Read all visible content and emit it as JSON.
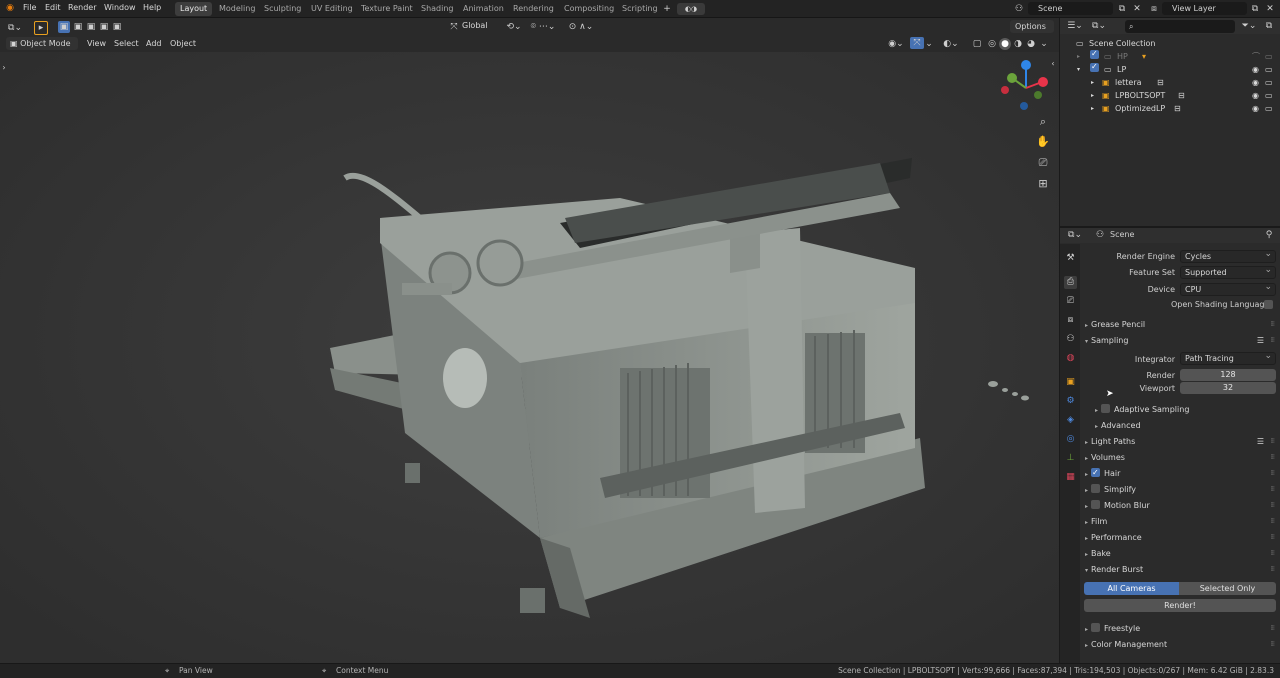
{
  "menu": [
    "File",
    "Edit",
    "Render",
    "Window",
    "Help"
  ],
  "workspaces": [
    "Layout",
    "Modeling",
    "Sculpting",
    "UV Editing",
    "Texture Paint",
    "Shading",
    "Animation",
    "Rendering",
    "Compositing",
    "Scripting"
  ],
  "active_workspace": "Layout",
  "scene_name": "Scene",
  "view_layer": "View Layer",
  "toolbar": {
    "orientation": "Global",
    "options": "Options"
  },
  "viewport_header": {
    "mode": "Object Mode",
    "menus": [
      "View",
      "Select",
      "Add",
      "Object"
    ]
  },
  "outliner": {
    "search_placeholder": "",
    "collection": "Scene Collection",
    "rows": [
      {
        "name": "HP",
        "level": 0
      },
      {
        "name": "LP",
        "level": 0
      },
      {
        "name": "lettera",
        "level": 1
      },
      {
        "name": "LPBOLTSOPT",
        "level": 1
      },
      {
        "name": "OptimizedLP",
        "level": 1
      }
    ]
  },
  "properties": {
    "header": "Scene",
    "render_engine_label": "Render Engine",
    "render_engine": "Cycles",
    "feature_set_label": "Feature Set",
    "feature_set": "Supported",
    "device_label": "Device",
    "device": "CPU",
    "osl_label": "Open Shading Language",
    "grease_pencil": "Grease Pencil",
    "sampling": "Sampling",
    "integrator_label": "Integrator",
    "integrator": "Path Tracing",
    "render_label": "Render",
    "render_samples": "128",
    "viewport_label": "Viewport",
    "viewport_samples": "32",
    "adaptive_sampling": "Adaptive Sampling",
    "advanced": "Advanced",
    "light_paths": "Light Paths",
    "volumes": "Volumes",
    "hair": "Hair",
    "simplify": "Simplify",
    "motion_blur": "Motion Blur",
    "film": "Film",
    "performance": "Performance",
    "bake": "Bake",
    "render_burst": "Render Burst",
    "all_cameras": "All Cameras",
    "selected_only": "Selected Only",
    "render_btn": "Render!",
    "freestyle": "Freestyle",
    "color_management": "Color Management"
  },
  "status": {
    "left1": "Pan View",
    "left2": "Context Menu",
    "right": "Scene Collection | LPBOLTSOPT | Verts:99,666 | Faces:87,394 | Tris:194,503 | Objects:0/267 | Mem: 6.42 GiB | 2.83.3"
  },
  "colors": {
    "accent": "#4772b3",
    "x_axis": "#e8344a",
    "y_axis": "#6ba33b",
    "z_axis": "#2f86e8"
  }
}
